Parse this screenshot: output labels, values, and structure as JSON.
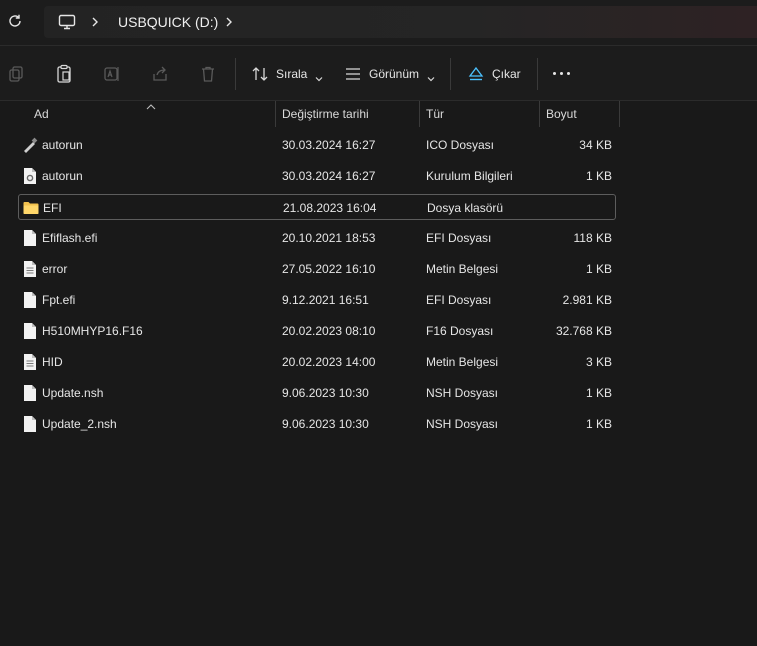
{
  "address": {
    "crumb": "USBQUICK (D:)"
  },
  "toolbar": {
    "sort_label": "Sırala",
    "view_label": "Görünüm",
    "eject_label": "Çıkar"
  },
  "columns": {
    "name": "Ad",
    "date": "Değiştirme tarihi",
    "type": "Tür",
    "size": "Boyut"
  },
  "files": [
    {
      "name": "autorun",
      "date": "30.03.2024 16:27",
      "type": "ICO Dosyası",
      "size": "34 KB",
      "icon": "usb-drive-icon"
    },
    {
      "name": "autorun",
      "date": "30.03.2024 16:27",
      "type": "Kurulum Bilgileri",
      "size": "1 KB",
      "icon": "settings-file-icon"
    },
    {
      "name": "EFI",
      "date": "21.08.2023 16:04",
      "type": "Dosya klasörü",
      "size": "",
      "icon": "folder-icon"
    },
    {
      "name": "Efiflash.efi",
      "date": "20.10.2021 18:53",
      "type": "EFI Dosyası",
      "size": "118 KB",
      "icon": "file-icon"
    },
    {
      "name": "error",
      "date": "27.05.2022 16:10",
      "type": "Metin Belgesi",
      "size": "1 KB",
      "icon": "text-file-icon"
    },
    {
      "name": "Fpt.efi",
      "date": "9.12.2021 16:51",
      "type": "EFI Dosyası",
      "size": "2.981 KB",
      "icon": "file-icon"
    },
    {
      "name": "H510MHYP16.F16",
      "date": "20.02.2023 08:10",
      "type": "F16 Dosyası",
      "size": "32.768 KB",
      "icon": "file-icon"
    },
    {
      "name": "HID",
      "date": "20.02.2023 14:00",
      "type": "Metin Belgesi",
      "size": "3 KB",
      "icon": "text-file-icon"
    },
    {
      "name": "Update.nsh",
      "date": "9.06.2023 10:30",
      "type": "NSH Dosyası",
      "size": "1 KB",
      "icon": "file-icon"
    },
    {
      "name": "Update_2.nsh",
      "date": "9.06.2023 10:30",
      "type": "NSH Dosyası",
      "size": "1 KB",
      "icon": "file-icon"
    }
  ],
  "colors": {
    "background": "#191919",
    "folder": "#f2c14e",
    "accent": "#4cc2ff"
  }
}
